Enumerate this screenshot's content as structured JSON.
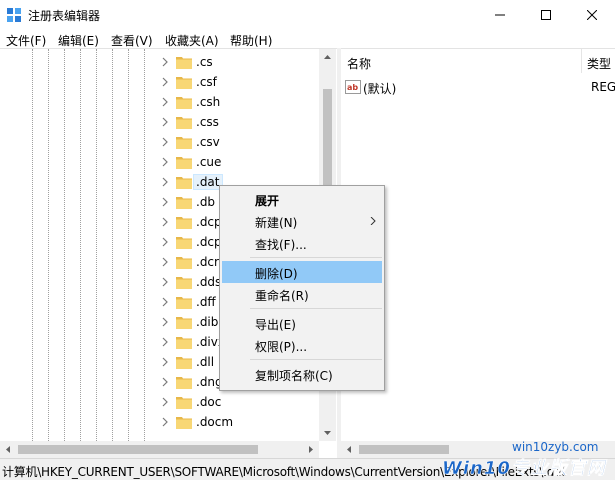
{
  "window": {
    "title": "注册表编辑器",
    "icon": "regedit-icon",
    "controls": {
      "minimize": "minimize-icon",
      "maximize": "maximize-icon",
      "close": "close-icon"
    }
  },
  "menubar": {
    "items": [
      "文件(F)",
      "编辑(E)",
      "查看(V)",
      "收藏夹(A)",
      "帮助(H)"
    ]
  },
  "tree": {
    "items": [
      ".cs",
      ".csf",
      ".csh",
      ".css",
      ".csv",
      ".cue",
      ".dat",
      ".db",
      ".dcp",
      ".dcp",
      ".dcr",
      ".dds",
      ".dff",
      ".dib",
      ".divx",
      ".dll",
      ".dng",
      ".doc",
      ".docm"
    ],
    "selected": ".dat"
  },
  "values_pane": {
    "columns": [
      "名称",
      "类型"
    ],
    "rows": [
      {
        "name": "(默认)",
        "type": "REG"
      }
    ]
  },
  "context_menu": {
    "items": [
      "展开",
      "新建(N)",
      "查找(F)...",
      "删除(D)",
      "重命名(R)",
      "导出(E)",
      "权限(P)...",
      "复制项名称(C)"
    ],
    "highlighted": "删除(D)"
  },
  "status_bar": {
    "path": "计算机\\HKEY_CURRENT_USER\\SOFTWARE\\Microsoft\\Windows\\CurrentVersion\\Explorer\\FileExts\\.dat"
  },
  "watermark": {
    "site": "win10zyb.com",
    "brand": "Win10专业版官网"
  },
  "colors": {
    "highlight": "#91c9f7",
    "selected_bg": "#e5f1fb",
    "folder": "#f8d775",
    "watermark": "#1a66c8"
  }
}
